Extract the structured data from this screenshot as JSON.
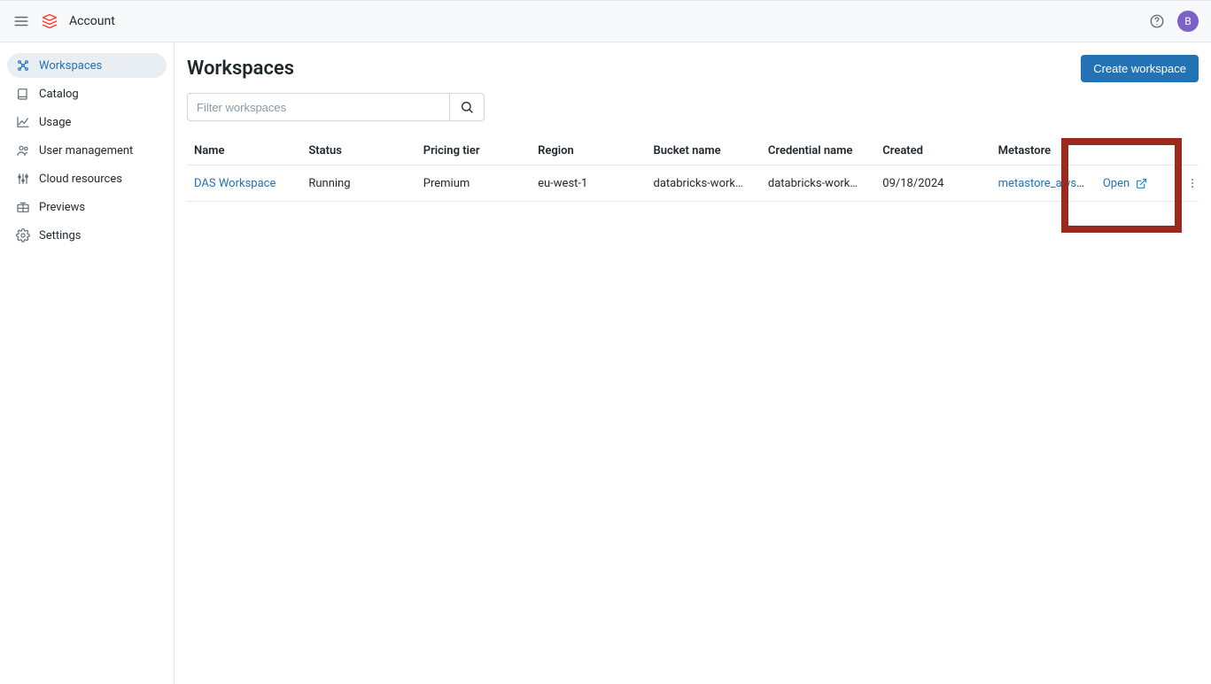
{
  "header": {
    "app_title": "Account",
    "avatar_initial": "B"
  },
  "sidebar": {
    "items": [
      {
        "label": "Workspaces"
      },
      {
        "label": "Catalog"
      },
      {
        "label": "Usage"
      },
      {
        "label": "User management"
      },
      {
        "label": "Cloud resources"
      },
      {
        "label": "Previews"
      },
      {
        "label": "Settings"
      }
    ]
  },
  "main": {
    "title": "Workspaces",
    "create_button": "Create workspace",
    "filter_placeholder": "Filter workspaces",
    "columns": {
      "name": "Name",
      "status": "Status",
      "tier": "Pricing tier",
      "region": "Region",
      "bucket": "Bucket name",
      "credential": "Credential name",
      "created": "Created",
      "metastore": "Metastore"
    },
    "rows": [
      {
        "name": "DAS Workspace",
        "status": "Running",
        "tier": "Premium",
        "region": "eu-west-1",
        "bucket": "databricks-work…",
        "credential": "databricks-work…",
        "created": "09/18/2024",
        "metastore": "metastore_aws_…",
        "open": "Open"
      }
    ]
  }
}
